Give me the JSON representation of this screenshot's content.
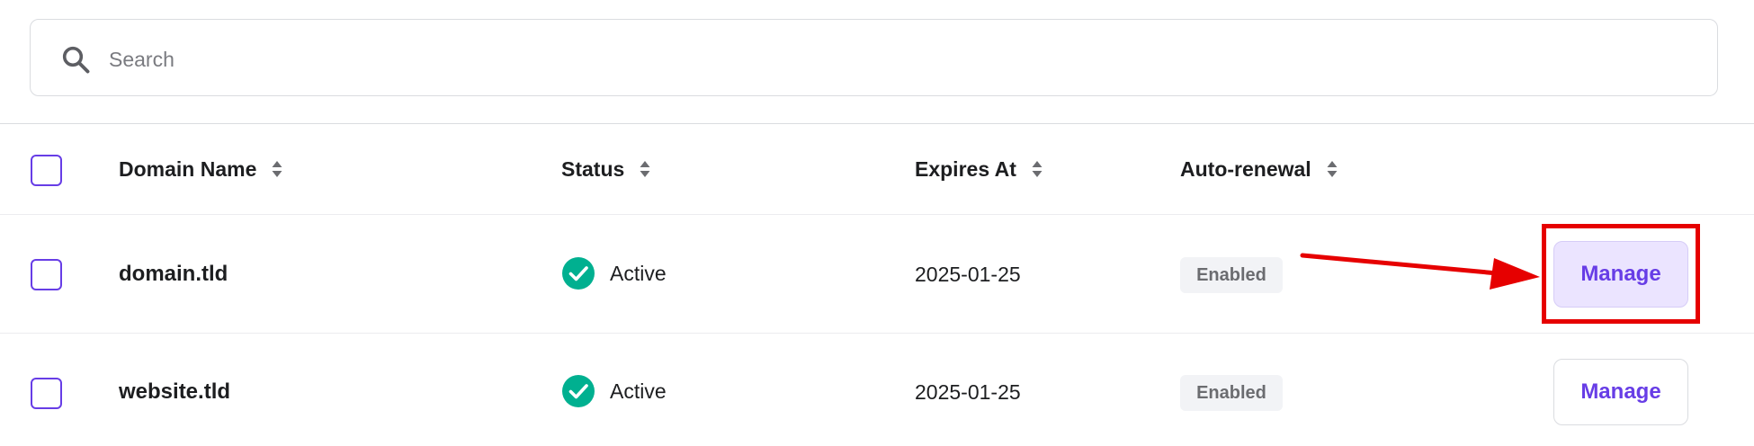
{
  "search": {
    "placeholder": "Search",
    "value": ""
  },
  "table": {
    "columns": [
      {
        "label": "Domain Name",
        "sortable": true
      },
      {
        "label": "Status",
        "sortable": true
      },
      {
        "label": "Expires At",
        "sortable": true
      },
      {
        "label": "Auto-renewal",
        "sortable": true
      }
    ],
    "rows": [
      {
        "selected": false,
        "domain": "domain.tld",
        "status": "Active",
        "expires_at": "2025-01-25",
        "auto_renewal": "Enabled",
        "action_label": "Manage",
        "highlighted": true
      },
      {
        "selected": false,
        "domain": "website.tld",
        "status": "Active",
        "expires_at": "2025-01-25",
        "auto_renewal": "Enabled",
        "action_label": "Manage",
        "highlighted": false
      }
    ]
  },
  "colors": {
    "accent": "#673de6",
    "status_active": "#00b090",
    "annotation": "#e60000",
    "highlight_bg": "#ebe4ff"
  },
  "icons": {
    "search": "search-icon",
    "sort": "sort-icon",
    "status_active": "check-circle-icon",
    "annotation_arrow": "arrow-icon"
  }
}
